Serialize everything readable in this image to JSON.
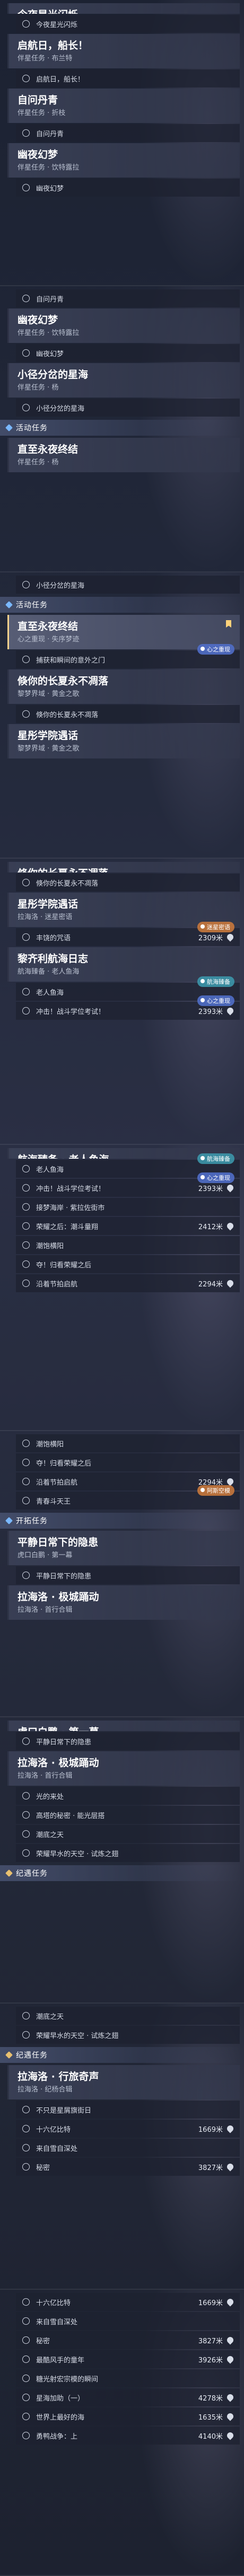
{
  "strips": [
    {
      "items": [
        {
          "kind": "quest",
          "title": "今夜星光闪烁",
          "sub": "伴星任务 · 吉可可",
          "cut": true
        },
        {
          "kind": "obj",
          "text": "今夜星光闪烁"
        },
        {
          "kind": "quest",
          "title": "启航日，船长！",
          "sub": "伴星任务 · 布兰特"
        },
        {
          "kind": "obj",
          "text": "启航日，船长！"
        },
        {
          "kind": "quest",
          "title": "自问丹青",
          "sub": "伴星任务 · 折枝"
        },
        {
          "kind": "obj",
          "text": "自问丹青"
        },
        {
          "kind": "quest",
          "title": "幽夜幻梦",
          "sub": "伴星任务 · 饮特露拉"
        },
        {
          "kind": "obj",
          "text": "幽夜幻梦"
        }
      ]
    },
    {
      "items": [
        {
          "kind": "obj",
          "text": "自问丹青"
        },
        {
          "kind": "quest",
          "title": "幽夜幻梦",
          "sub": "伴星任务 · 饮特露拉"
        },
        {
          "kind": "obj",
          "text": "幽夜幻梦"
        },
        {
          "kind": "quest",
          "title": "小径分岔的星海",
          "sub": "伴星任务 · 杨"
        },
        {
          "kind": "obj",
          "text": "小径分岔的星海"
        },
        {
          "kind": "header",
          "style": "trailblaze",
          "text": "活动任务"
        },
        {
          "kind": "quest",
          "title": "直至永夜终结",
          "sub": "伴星任务 · 杨"
        }
      ]
    },
    {
      "items": [
        {
          "kind": "obj",
          "text": "小径分岔的星海"
        },
        {
          "kind": "header",
          "style": "trailblaze",
          "text": "活动任务"
        },
        {
          "kind": "quest",
          "title": "直至永夜终结",
          "sub": "心之重现 · 失序梦迹",
          "active": true
        },
        {
          "kind": "obj",
          "text": "捕获和瞬间的意外之门",
          "badge": "心之重现",
          "badgeStyle": "blue"
        },
        {
          "kind": "quest",
          "title": "倏你的长夏永不凋落",
          "sub": "黎梦界域 · 黄金之歌"
        },
        {
          "kind": "obj",
          "text": "倏你的长夏永不凋落"
        },
        {
          "kind": "quest",
          "title": "星彤学院遇话",
          "sub": "黎梦界域 · 黄金之歌"
        }
      ]
    },
    {
      "items": [
        {
          "kind": "quest",
          "title": "倏你的长夏永不凋落",
          "sub": "黎梦界域 · 黄金之歌",
          "cut": true
        },
        {
          "kind": "obj",
          "text": "倏你的长夏永不凋落"
        },
        {
          "kind": "quest",
          "title": "星彤学院遇话",
          "sub": "拉海洛 · 迷星密语"
        },
        {
          "kind": "obj",
          "text": "丰饶的咒语",
          "dist": "2309米",
          "badge": "迷星密语",
          "badgeStyle": "orange"
        },
        {
          "kind": "quest",
          "title": "黎齐利航海日志",
          "sub": "航海臻备 · 老人鱼海"
        },
        {
          "kind": "obj",
          "text": "老人鱼海",
          "badge": "航海臻备",
          "badgeStyle": "teal"
        },
        {
          "kind": "obj",
          "text": "冲击！战斗学位考试！",
          "dist": "2393米",
          "badge": "心之重现",
          "badgeStyle": "blue"
        }
      ]
    },
    {
      "items": [
        {
          "kind": "quest",
          "title": "航海臻备 · 老人鱼海",
          "sub": "",
          "cut": true
        },
        {
          "kind": "obj",
          "text": "老人鱼海",
          "badge": "航海臻备",
          "badgeStyle": "teal"
        },
        {
          "kind": "obj",
          "text": "冲击！战斗学位考试！",
          "dist": "2393米",
          "badge": "心之重现",
          "badgeStyle": "blue"
        },
        {
          "kind": "obj",
          "text": "接梦海岸 · 紫拉佐街市"
        },
        {
          "kind": "obj",
          "text": "荣耀之后：潮斗量翔",
          "dist": "2412米"
        },
        {
          "kind": "obj",
          "text": "潮饱横阳"
        },
        {
          "kind": "obj",
          "text": "夺！归看荣耀之后"
        },
        {
          "kind": "obj",
          "text": "沿着节拍启航",
          "dist": "2294米"
        }
      ]
    },
    {
      "items": [
        {
          "kind": "obj",
          "text": "潮饱横阳"
        },
        {
          "kind": "obj",
          "text": "夺！归看荣耀之后"
        },
        {
          "kind": "obj",
          "text": "沿着节拍启航",
          "dist": "2294米"
        },
        {
          "kind": "obj",
          "text": "青春斗天王",
          "badge": "阿斯空模",
          "badgeStyle": "orange"
        },
        {
          "kind": "header",
          "style": "trailblaze",
          "text": "开拓任务"
        },
        {
          "kind": "quest",
          "title": "平静日常下的隐患",
          "sub": "虎口白鹏 · 第一幕"
        },
        {
          "kind": "obj",
          "text": "平静日常下的隐患"
        },
        {
          "kind": "quest",
          "title": "拉海洛 · 极城踊动",
          "sub": "拉海洛 · 首行合辑"
        }
      ]
    },
    {
      "items": [
        {
          "kind": "quest",
          "title": "虎口白鹏 · 第一幕",
          "sub": "",
          "cut": true
        },
        {
          "kind": "obj",
          "text": "平静日常下的隐患"
        },
        {
          "kind": "quest",
          "title": "拉海洛 · 极城踊动",
          "sub": "拉海洛 · 首行合辑"
        },
        {
          "kind": "obj",
          "text": "光的来处"
        },
        {
          "kind": "obj",
          "text": "高塔的秘密 · 能光层搭"
        },
        {
          "kind": "obj",
          "text": "潮底之天"
        },
        {
          "kind": "obj",
          "text": "荣耀早水的天空 · 试炼之翅"
        },
        {
          "kind": "header",
          "style": "companion",
          "text": "纪遇任务"
        }
      ]
    },
    {
      "items": [
        {
          "kind": "obj",
          "text": "潮底之天"
        },
        {
          "kind": "obj",
          "text": "荣耀早水的天空 · 试炼之翅"
        },
        {
          "kind": "header",
          "style": "companion",
          "text": "纪遇任务"
        },
        {
          "kind": "quest",
          "title": "拉海洛 · 行旅奇声",
          "sub": "拉海洛 · 纪杨合辑"
        },
        {
          "kind": "obj",
          "text": "不只是星屑旗街日"
        },
        {
          "kind": "obj",
          "text": "十六亿比特",
          "dist": "1669米"
        },
        {
          "kind": "obj",
          "text": "来自雪自深处"
        },
        {
          "kind": "obj",
          "text": "秘密",
          "dist": "3827米"
        }
      ]
    },
    {
      "items": [
        {
          "kind": "obj",
          "text": "十六亿比特",
          "dist": "1669米"
        },
        {
          "kind": "obj",
          "text": "来自雪自深处"
        },
        {
          "kind": "obj",
          "text": "秘密",
          "dist": "3827米"
        },
        {
          "kind": "obj",
          "text": "最酷风手的童年",
          "dist": "3926米"
        },
        {
          "kind": "obj",
          "text": "糖光射宏宗模的瞬间"
        },
        {
          "kind": "obj",
          "text": "星海加助（一）",
          "dist": "4278米"
        },
        {
          "kind": "obj",
          "text": "世界上最好的海",
          "dist": "1635米"
        },
        {
          "kind": "obj",
          "text": "勇鸭战争：上",
          "dist": "4140米"
        }
      ]
    }
  ]
}
